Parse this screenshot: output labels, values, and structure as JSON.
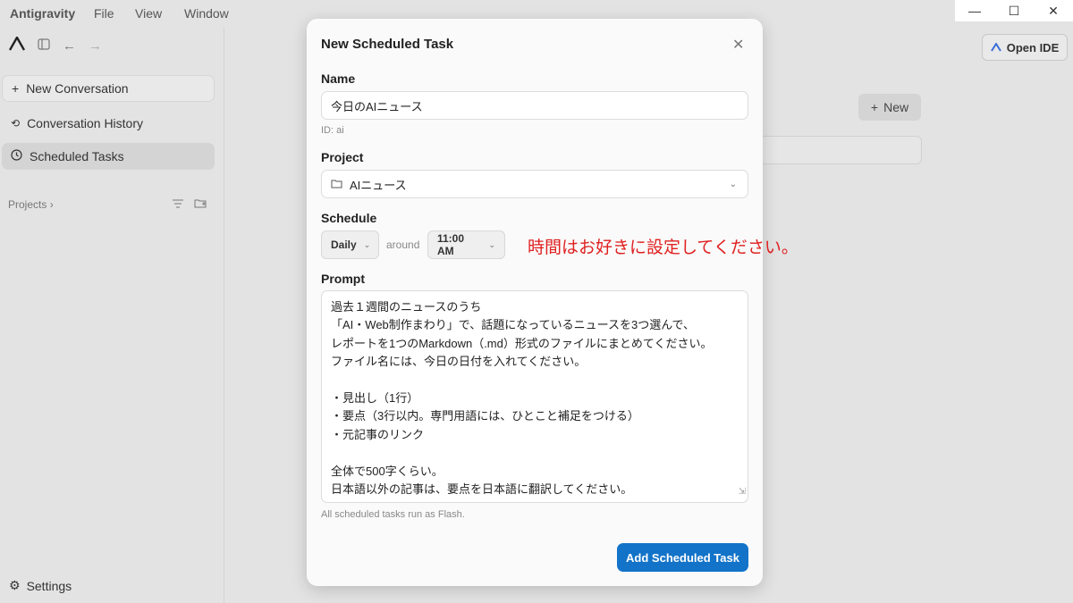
{
  "menubar": {
    "items": [
      "Antigravity",
      "File",
      "View",
      "Window"
    ]
  },
  "window_controls": {
    "minimize": "—",
    "maximize": "☐",
    "close": "✕"
  },
  "sidebar": {
    "new_conversation": "New Conversation",
    "conversation_history": "Conversation History",
    "scheduled_tasks": "Scheduled Tasks",
    "projects": "Projects",
    "settings": "Settings"
  },
  "header": {
    "open_ide": "Open IDE"
  },
  "main": {
    "new_button": "New"
  },
  "modal": {
    "title": "New Scheduled Task",
    "name_label": "Name",
    "name_value": "今日のAIニュース",
    "id_hint": "ID: ai",
    "project_label": "Project",
    "project_value": "AIニュース",
    "schedule_label": "Schedule",
    "frequency": "Daily",
    "around": "around",
    "time": "11:00 AM",
    "prompt_label": "Prompt",
    "prompt_lines": [
      "過去１週間のニュースのうち",
      "「AI・Web制作まわり」で、話題になっているニュースを3つ選んで、",
      "レポートを1つのMarkdown（.md）形式のファイルにまとめてください。",
      "ファイル名には、今日の日付を入れてください。",
      "",
      "・見出し（1行）",
      "・要点（3行以内。専門用語には、ひとこと補足をつける）",
      "・元記事のリンク",
      "",
      "全体で500字くらい。",
      "日本語以外の記事は、要点を日本語に翻訳してください。"
    ],
    "flash_hint": "All scheduled tasks run as Flash.",
    "submit": "Add Scheduled Task"
  },
  "annotation": "時間はお好きに設定してください。",
  "colors": {
    "accent": "#1273c9",
    "annotation": "#e02020",
    "background": "#e3e3e3"
  }
}
